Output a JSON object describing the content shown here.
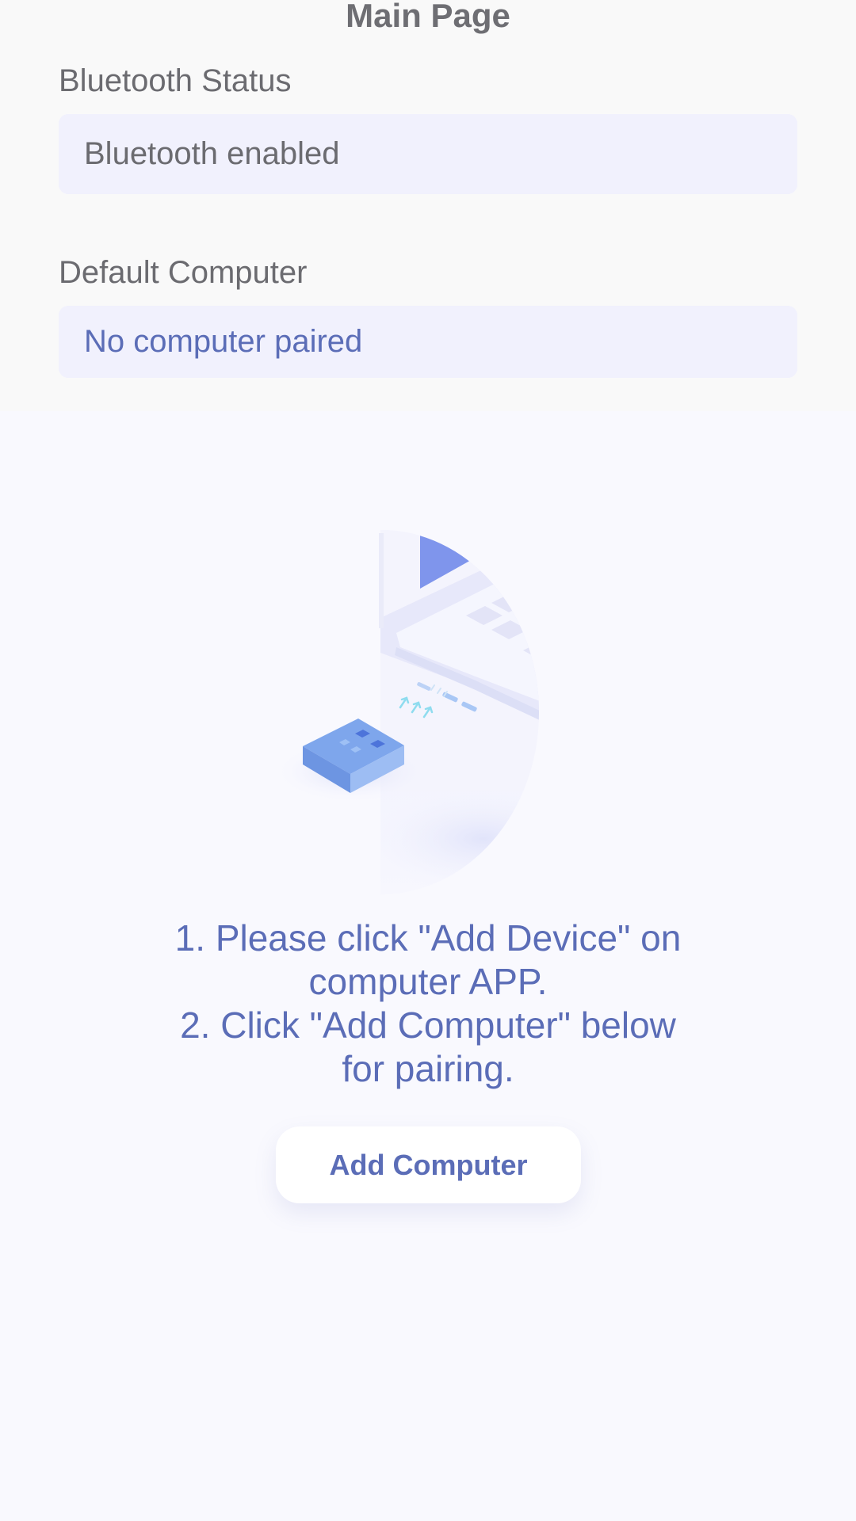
{
  "header": {
    "title": "Main Page"
  },
  "bluetooth": {
    "label": "Bluetooth Status",
    "value": "Bluetooth enabled"
  },
  "default_computer": {
    "label": "Default Computer",
    "value": "No computer paired"
  },
  "illustration": {
    "icon": "usb-dongle-to-laptop-illustration"
  },
  "instructions": {
    "line1": "1. Please click \"Add Device\" on",
    "line2": "computer APP.",
    "line3": "2. Click \"Add Computer\" below",
    "line4": "for pairing."
  },
  "actions": {
    "add_computer_label": "Add Computer"
  },
  "colors": {
    "accent": "#5b6db7",
    "field_bg": "#f1f1fd",
    "text_muted": "#6b6b70"
  }
}
